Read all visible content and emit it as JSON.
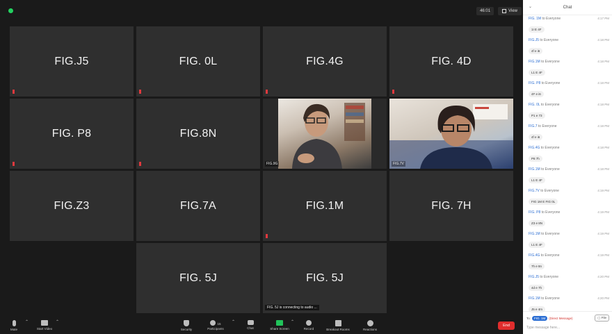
{
  "window": {
    "timer": "46:01",
    "view_label": "View"
  },
  "tiles": [
    {
      "name": "FIG.J5"
    },
    {
      "name": "FIG. 0L"
    },
    {
      "name": "FIG.4G"
    },
    {
      "name": "FIG. 4D"
    },
    {
      "name": "FIG. P8"
    },
    {
      "name": "FIG.8N"
    },
    {
      "name": "",
      "video_label": "FIG.9G"
    },
    {
      "name": "",
      "video_label": "FIG.7V"
    },
    {
      "name": "FIG.Z3"
    },
    {
      "name": "FIG.7A"
    },
    {
      "name": "FIG.1M"
    },
    {
      "name": "FIG. 7H"
    },
    {
      "name": "FIG. 5J"
    },
    {
      "name": "FIG. 5J",
      "status": "FIG. 5J is connecting to audio ..."
    }
  ],
  "toolbar": {
    "mute": "Mute",
    "start_video": "Start Video",
    "security": "Security",
    "participants": "Participants",
    "participants_count": "15",
    "chat": "Chat",
    "share_screen": "Share Screen",
    "record": "Record",
    "breakout": "Breakout Rooms",
    "reactions": "Reactions",
    "end": "End"
  },
  "chat": {
    "title": "Chat",
    "messages": [
      {
        "from": "FIG. 1M",
        "to": "to Everyone",
        "time": "4:17 PM",
        "text": "1I E 4F"
      },
      {
        "from": "FIG.J5",
        "to": "to Everyone",
        "time": "4:18 PM",
        "text": "4f e i6"
      },
      {
        "from": "FIG.1M",
        "to": "to Everyone",
        "time": "4:18 PM",
        "text": "L1 E 4F"
      },
      {
        "from": "FIG. P8",
        "to": "to Everyone",
        "time": "4:18 PM",
        "text": "4F e i6"
      },
      {
        "from": "FIG. 0L",
        "to": "to Everyone",
        "time": "4:18 PM",
        "text": "P1 e 73"
      },
      {
        "from": "FIG.7",
        "to": "to Everyone",
        "time": "4:18 PM",
        "text": "4f e i6"
      },
      {
        "from": "FIG.4G",
        "to": "to Everyone",
        "time": "4:18 PM",
        "text": "P8 7h"
      },
      {
        "from": "FIG.1M",
        "to": "to Everyone",
        "time": "4:18 PM",
        "text": "L1 E 4F"
      },
      {
        "from": "FIG.7V",
        "to": "to Everyone",
        "time": "4:19 PM",
        "text": "FIG 1M E FIG 0L"
      },
      {
        "from": "FIG. P8",
        "to": "to Everyone",
        "time": "4:19 PM",
        "text": "Z3 e 8N"
      },
      {
        "from": "FIG.1M",
        "to": "to Everyone",
        "time": "4:19 PM",
        "text": "L1 E 4F"
      },
      {
        "from": "FIG.4G",
        "to": "to Everyone",
        "time": "4:19 PM",
        "text": "7h e 8n"
      },
      {
        "from": "FIG.J5",
        "to": "to Everyone",
        "time": "4:20 PM",
        "text": "4d e 7h"
      },
      {
        "from": "FIG.1M",
        "to": "to Everyone",
        "time": "4:20 PM",
        "text": "J5 e 4m"
      }
    ],
    "to_label": "To:",
    "to_value": "FIG. 1M",
    "direct_label": "(Direct Message)",
    "file_label": "File",
    "placeholder": "Type message here..."
  }
}
